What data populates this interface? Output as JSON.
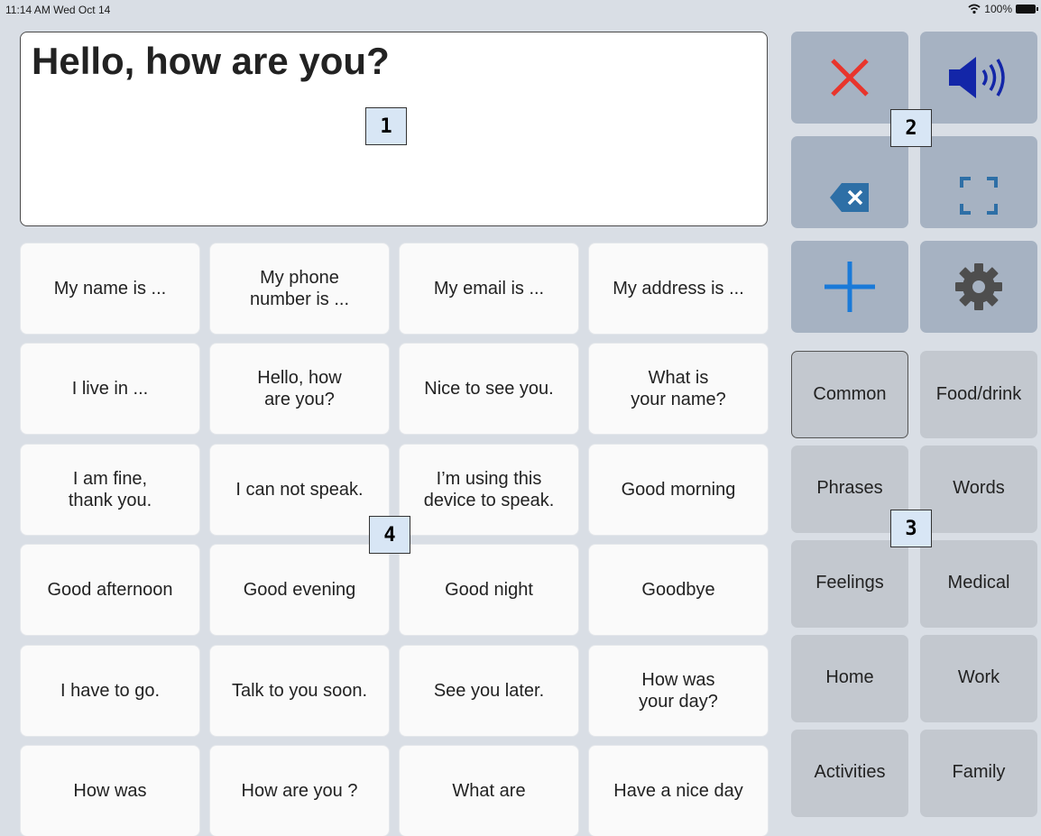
{
  "status": {
    "time": "11:14 AM  Wed Oct 14",
    "battery": "100%"
  },
  "message": {
    "text": "Hello, how are you?"
  },
  "markers": [
    "1",
    "2",
    "3",
    "4"
  ],
  "controls": [
    {
      "name": "clear-button",
      "icon": "x-icon"
    },
    {
      "name": "speak-button",
      "icon": "speaker-icon"
    },
    {
      "name": "backspace-button",
      "icon": "backspace-icon"
    },
    {
      "name": "fullscreen-button",
      "icon": "fullscreen-icon"
    },
    {
      "name": "add-button",
      "icon": "plus-icon"
    },
    {
      "name": "settings-button",
      "icon": "gear-icon"
    }
  ],
  "colors": {
    "clear": "#e8352c",
    "speaker": "#1326a8",
    "backspace": "#2e6fa6",
    "plus": "#1a7ad8",
    "gear": "#4e4e4e"
  },
  "phrases": [
    [
      "My name is ...",
      "My phone\nnumber is ...",
      "My email is ...",
      "My address is ..."
    ],
    [
      "I live in ...",
      "Hello, how\nare you?",
      "Nice to see you.",
      "What is\nyour name?"
    ],
    [
      "I am fine,\nthank you.",
      "I can not speak.",
      "I’m using this\ndevice to speak.",
      "Good morning"
    ],
    [
      "Good afternoon",
      "Good evening",
      "Good night",
      "Goodbye"
    ],
    [
      "I have to go.",
      "Talk to you soon.",
      "See you later.",
      "How was\nyour day?"
    ],
    [
      "How was",
      "How are you ?",
      "What are",
      "Have a nice day"
    ]
  ],
  "categories": [
    [
      "Common",
      "Food/drink"
    ],
    [
      "Phrases",
      "Words"
    ],
    [
      "Feelings",
      "Medical"
    ],
    [
      "Home",
      "Work"
    ],
    [
      "Activities",
      "Family"
    ]
  ],
  "selected_category": "Common"
}
